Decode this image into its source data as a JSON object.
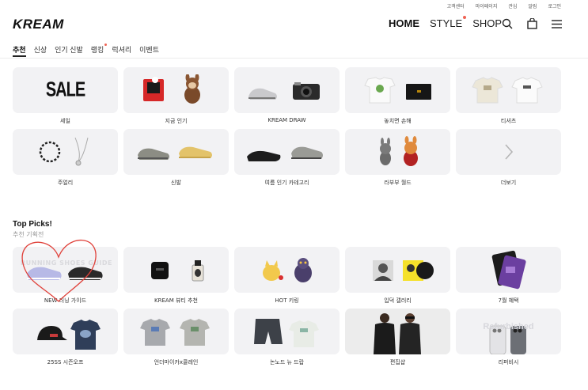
{
  "utility_links": [
    "고객센터",
    "마이페이지",
    "관심",
    "알림",
    "로그인"
  ],
  "logo": "KREAM",
  "main_nav": [
    {
      "label": "HOME",
      "active": true,
      "dot": false
    },
    {
      "label": "STYLE",
      "active": false,
      "dot": true
    },
    {
      "label": "SHOP",
      "active": false,
      "dot": false
    }
  ],
  "header_icons": [
    "search-icon",
    "bag-icon",
    "menu-icon"
  ],
  "tabs": [
    {
      "label": "추천",
      "active": true,
      "dot": false
    },
    {
      "label": "신상",
      "active": false,
      "dot": false
    },
    {
      "label": "인기 신발",
      "active": false,
      "dot": false
    },
    {
      "label": "랭킹",
      "active": false,
      "dot": true
    },
    {
      "label": "럭셔리",
      "active": false,
      "dot": false
    },
    {
      "label": "이벤트",
      "active": false,
      "dot": false
    }
  ],
  "shortcuts": [
    {
      "label": "세일",
      "sale_text": "SALE"
    },
    {
      "label": "지금 인기"
    },
    {
      "label": "KREAM DRAW"
    },
    {
      "label": "놓치면 손해"
    },
    {
      "label": "티셔츠"
    },
    {
      "label": "주얼리"
    },
    {
      "label": "신발"
    },
    {
      "label": "여름 인기 카테고리"
    },
    {
      "label": "라부부 월드"
    },
    {
      "label": "더보기"
    }
  ],
  "top_picks": {
    "title": "Top Picks!",
    "subtitle": "추천 기획전",
    "items": [
      {
        "label": "NEW 러닝 가이드",
        "overlay": "RUNNING SHOES GUIDE"
      },
      {
        "label": "KREAM 뷰티 추천"
      },
      {
        "label": "HOT 키링"
      },
      {
        "label": "입덕 갤러리"
      },
      {
        "label": "7월 혜택"
      },
      {
        "label": "25SS 시즌오프"
      },
      {
        "label": "언더마이카x콜레인"
      },
      {
        "label": "논노드 뉴 드랍"
      },
      {
        "label": "편집샵"
      },
      {
        "label": "리퍼비시",
        "overlay": "Refurbished"
      }
    ]
  },
  "colors": {
    "accent_dot": "#ef6253",
    "tile_bg": "#f2f2f4",
    "heart_doodle": "#e0413a"
  }
}
